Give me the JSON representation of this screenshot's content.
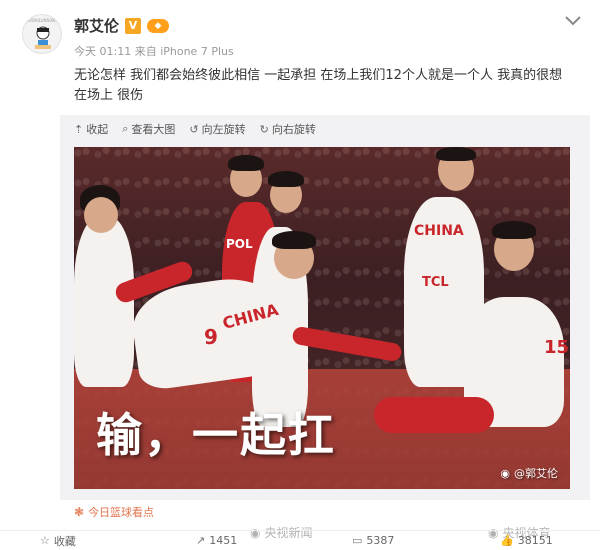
{
  "author": {
    "name": "郭艾伦",
    "verified_icon": "V",
    "level_badge": "◆",
    "avatar_text": "GUOAILUNSONG"
  },
  "meta": {
    "time": "今天 01:11",
    "source": "来自 iPhone 7 Plus"
  },
  "post": {
    "text": "无论怎样 我们都会始终彼此相信 一起承担 在场上我们12个人就是一个人 我真的很想在场上 很伤"
  },
  "media_toolbar": {
    "collapse": "收起",
    "view_large": "查看大图",
    "rotate_left": "向左旋转",
    "rotate_right": "向右旋转"
  },
  "photo": {
    "caption": "输，一起扛",
    "jersey_china": "CHINA",
    "jersey_pol": "POL",
    "jersey_tcl": "TCL",
    "jersey_num_9": "9",
    "jersey_num_15": "15",
    "watermark": "@郭艾伦"
  },
  "topic": {
    "label": "今日篮球看点"
  },
  "actions": {
    "favorite": "收藏",
    "share_count": "1451",
    "comment_count": "5387",
    "like_count": "38151"
  },
  "watermarks": {
    "cctv_news": "央视新闻",
    "cctv_sports": "央视体育"
  },
  "colors": {
    "accent_orange": "#e0754f",
    "verified": "#f5a623",
    "china_red": "#c9262c"
  }
}
